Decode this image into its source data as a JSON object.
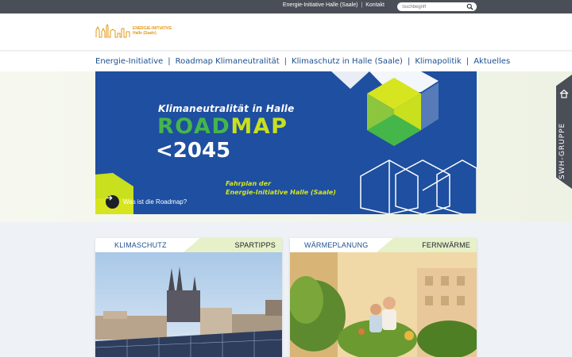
{
  "topbar": {
    "link_home": "Energie-Initiative Halle (Saale)",
    "separator": "|",
    "link_contact": "Kontakt",
    "search_placeholder": "Suchbegriff",
    "search_icon": "search-icon"
  },
  "logo": {
    "line1": "ENERGIE-INITIATIVE",
    "line2": "Halle (Saale)"
  },
  "nav": {
    "items": [
      "Energie-Initiative",
      "Roadmap Klimaneutralität",
      "Klimaschutz in Halle (Saale)",
      "Klimapolitik",
      "Aktuelles"
    ],
    "divider": "|"
  },
  "hero": {
    "subtitle": "Klimaneutralität in Halle",
    "headline_part1": "ROAD",
    "headline_part2": "MAP",
    "year": "<2045",
    "fahrplan_line1": "Fahrplan der",
    "fahrplan_line2": "Energie-Initiative Halle (Saale)",
    "cta_label": "Was ist die Roadmap?",
    "cta_icon": "arrow-right-icon",
    "colors": {
      "background": "#1e4fa0",
      "green": "#45b649",
      "lime": "#c8e01e"
    }
  },
  "sidetab": {
    "label": "SWH-GRUPPE",
    "icon": "house-icon"
  },
  "cards": [
    {
      "tab_left": "KLIMASCHUTZ",
      "tab_right": "SPARTIPPS",
      "image": "city-skyline-with-solar-panels"
    },
    {
      "tab_left": "WÄRMEPLANUNG",
      "tab_right": "FERNWÄRME",
      "image": "couple-on-balcony-with-plants"
    }
  ]
}
